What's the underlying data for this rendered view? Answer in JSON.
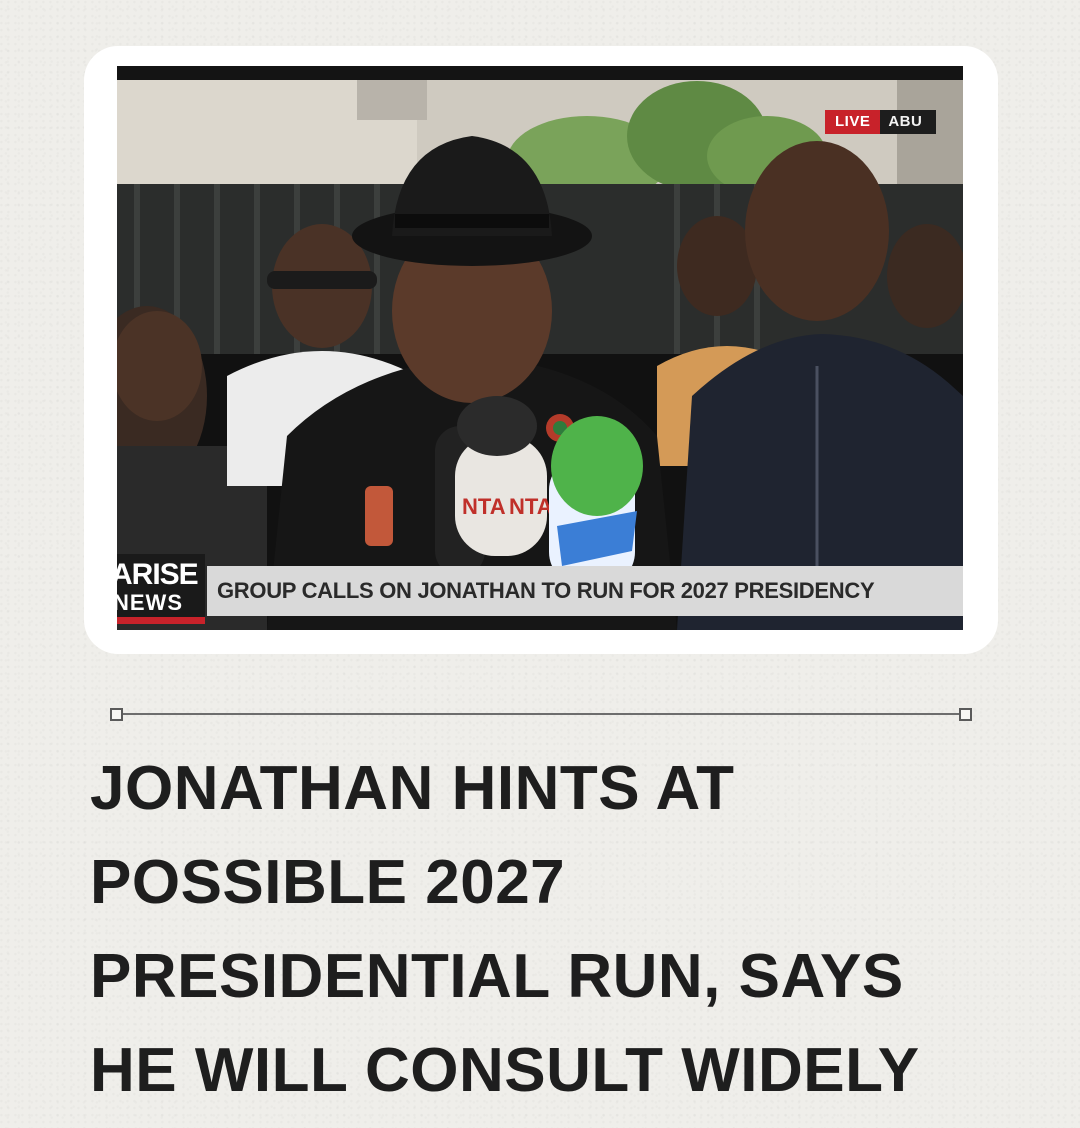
{
  "post": {
    "headline": "JONATHAN HINTS AT\nPOSSIBLE 2027\nPRESIDENTIAL RUN, SAYS\nHE WILL CONSULT WIDELY"
  },
  "video": {
    "live_label": "LIVE",
    "location_label": "ABU",
    "brand_line1": "ARISE",
    "brand_line2": "NEWS",
    "ticker_text": "GROUP CALLS ON JONATHAN TO RUN FOR 2027 PRESIDENCY",
    "mic_labels": [
      "NTA",
      "NTA"
    ]
  },
  "colors": {
    "background": "#efeeea",
    "live_red": "#c8222a",
    "ticker_bg": "#d9d9d9",
    "headline_text": "#1e1e1e"
  }
}
